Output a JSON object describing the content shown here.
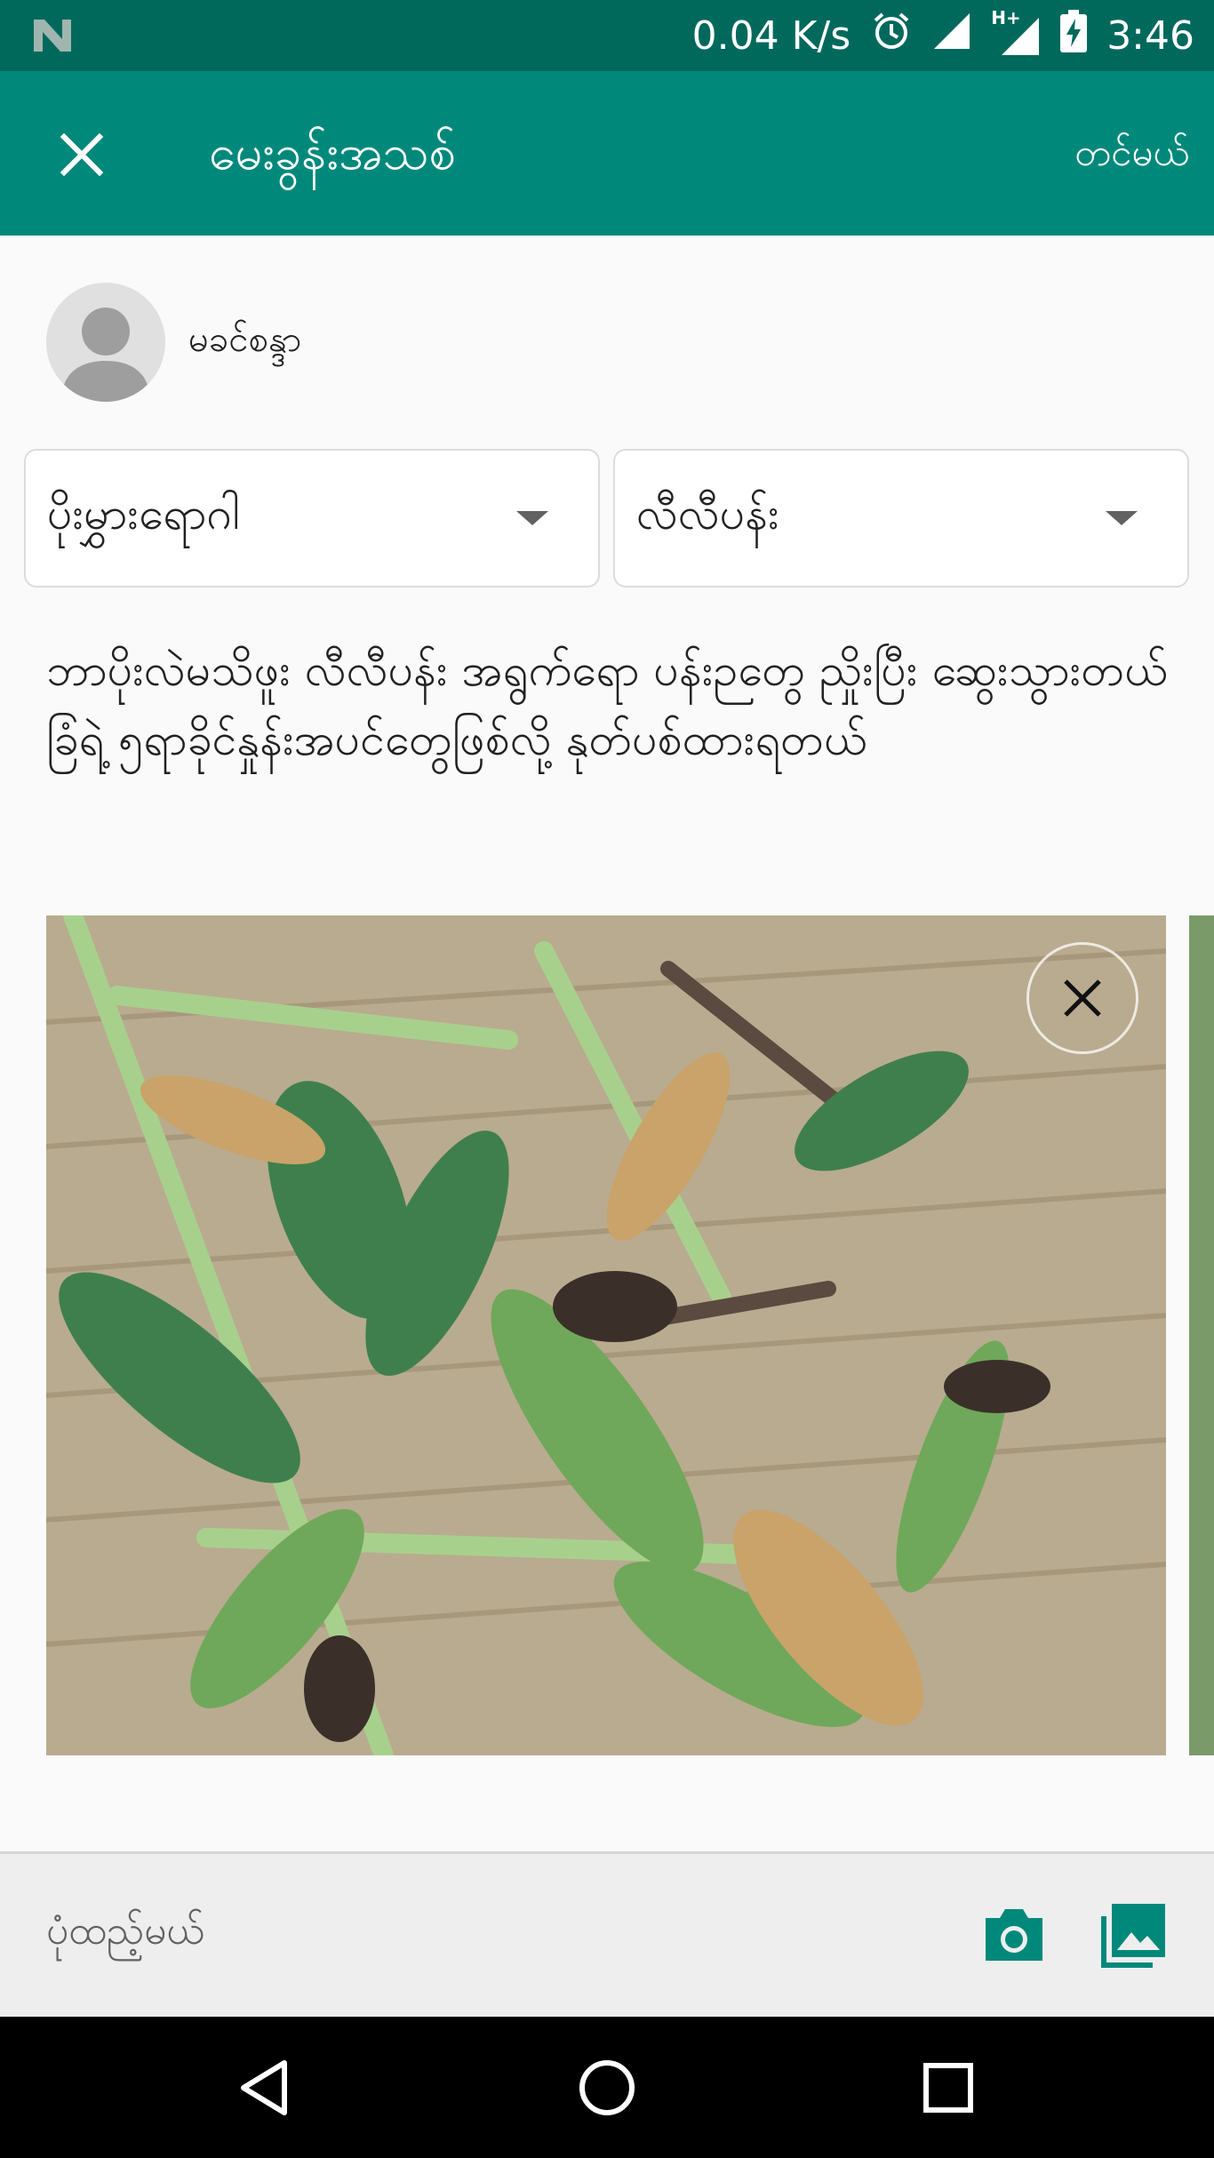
{
  "status_bar": {
    "speed": "0.04 K/s",
    "network_type": "H+",
    "time": "3:46"
  },
  "app_bar": {
    "title": "မေးခွန်းအသစ်",
    "post_label": "တင်မယ်"
  },
  "author": {
    "name": "မခင်စန္ဒာ"
  },
  "dropdowns": {
    "category": "ပိုးမွှားရောဂါ",
    "crop": "လီလီပန်း"
  },
  "post_body": "ဘာပိုးလဲမသိဖူး လီလီပန်း အရွက်ရော ပန်းဉတွေ ညှိုးပြီး ဆွေးသွားတယ်\nခြံရဲ့ ၅ရာခိုင်နှုန်းအပင်တွေဖြစ်လို့ နုတ်ပစ်ထားရတယ်",
  "compose": {
    "placeholder": "ပုံထည့်မယ်"
  },
  "colors": {
    "primary": "#00897b",
    "primary_dark": "#00695c",
    "accent": "#00897b"
  }
}
